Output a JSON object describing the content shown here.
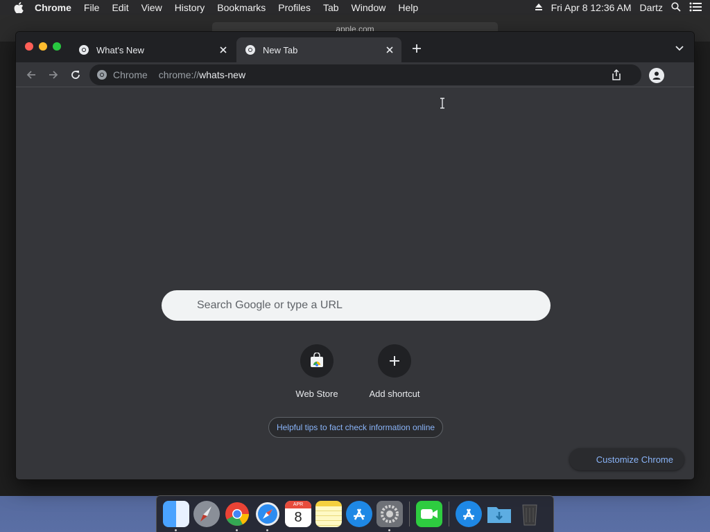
{
  "menubar": {
    "app": "Chrome",
    "items": [
      "File",
      "Edit",
      "View",
      "History",
      "Bookmarks",
      "Profiles",
      "Tab",
      "Window",
      "Help"
    ],
    "datetime": "Fri Apr 8  12:36 AM",
    "user": "Dartz"
  },
  "background_window": {
    "url": "apple.com"
  },
  "tabs": [
    {
      "label": "What's New",
      "active": false
    },
    {
      "label": "New Tab",
      "active": true
    }
  ],
  "omnibox": {
    "chip": "Chrome",
    "url_scheme": "chrome://",
    "url_path": "whats-new"
  },
  "ntp": {
    "search_placeholder": "Search Google or type a URL",
    "shortcuts": [
      {
        "label": "Web Store",
        "icon": "web-store-icon"
      },
      {
        "label": "Add shortcut",
        "icon": "plus-icon"
      }
    ],
    "tips_chip": "Helpful tips to fact check information online",
    "customize": "Customize Chrome"
  },
  "dock": {
    "calendar_day": "8",
    "calendar_month": "APR",
    "apps": [
      "finder",
      "launchpad",
      "chrome",
      "safari",
      "calendar",
      "notes",
      "app-store",
      "system-preferences",
      "facetime",
      "app-store-2",
      "downloads",
      "trash"
    ]
  },
  "colors": {
    "chrome_bg": "#35363a",
    "tabstrip": "#202124",
    "link_blue": "#8ab4f8"
  }
}
